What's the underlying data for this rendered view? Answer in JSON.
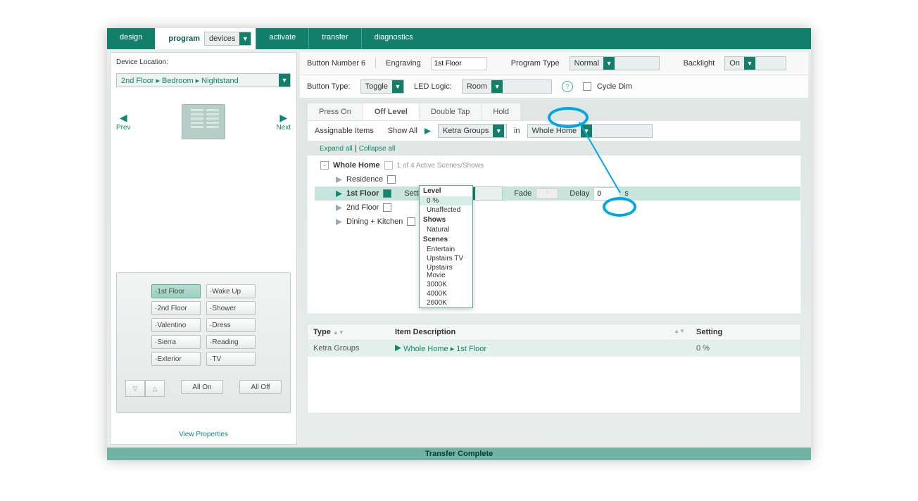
{
  "topbar": {
    "design": "design",
    "program": "program",
    "program_dd": "devices",
    "activate": "activate",
    "transfer": "transfer",
    "diagnostics": "diagnostics"
  },
  "left": {
    "loc_label": "Device Location:",
    "crumbs": [
      "2nd Floor",
      "Bedroom",
      "Nightstand"
    ],
    "prev": "Prev",
    "next": "Next",
    "view_props": "View Properties"
  },
  "keypad": {
    "col1": [
      "1st Floor",
      "2nd Floor",
      "Valentino",
      "Sierra",
      "Exterior"
    ],
    "col2": [
      "Wake Up",
      "Shower",
      "Dress",
      "Reading",
      "TV"
    ],
    "all_on": "All On",
    "all_off": "All Off"
  },
  "cfg": {
    "btn_num_label": "Button Number 6",
    "engraving_label": "Engraving",
    "engraving_value": "1st Floor",
    "program_type_label": "Program Type",
    "program_type_value": "Normal",
    "backlight_label": "Backlight",
    "backlight_value": "On",
    "button_type_label": "Button Type:",
    "button_type_value": "Toggle",
    "led_logic_label": "LED Logic:",
    "led_logic_value": "Room",
    "cycle_dim_label": "Cycle Dim"
  },
  "tabs": {
    "press_on": "Press On",
    "off_level": "Off Level",
    "double_tap": "Double Tap",
    "hold": "Hold"
  },
  "assign": {
    "label": "Assignable Items",
    "show_all": "Show All",
    "ketra_groups": "Ketra Groups",
    "in": "in",
    "whole_home": "Whole Home",
    "expand_all": "Expand all",
    "collapse_all": "Collapse all"
  },
  "tree": {
    "root": "Whole Home",
    "count": "1 of 4 Active Scenes/Shows",
    "items": [
      "Residence",
      "1st Floor",
      "2nd Floor",
      "Dining + Kitchen"
    ],
    "settings_label": "Settings",
    "fade_label": "Fade",
    "fade_value": "-",
    "delay_label": "Delay",
    "delay_value": "0",
    "delay_unit": "s"
  },
  "popup": {
    "sections": [
      {
        "header": "Level",
        "options": [
          "0 %",
          "Unaffected"
        ]
      },
      {
        "header": "Shows",
        "options": [
          "Natural"
        ]
      },
      {
        "header": "Scenes",
        "options": [
          "Entertain",
          "Upstairs TV",
          "Upstairs Movie",
          "3000K",
          "4000K",
          "2600K"
        ]
      }
    ]
  },
  "grid": {
    "h_type": "Type",
    "h_desc": "Item Description",
    "h_setting": "Setting",
    "row_type": "Ketra Groups",
    "row_desc_a": "Whole Home",
    "row_desc_b": "1st Floor",
    "row_setting": "0 %"
  },
  "status": "Transfer Complete"
}
